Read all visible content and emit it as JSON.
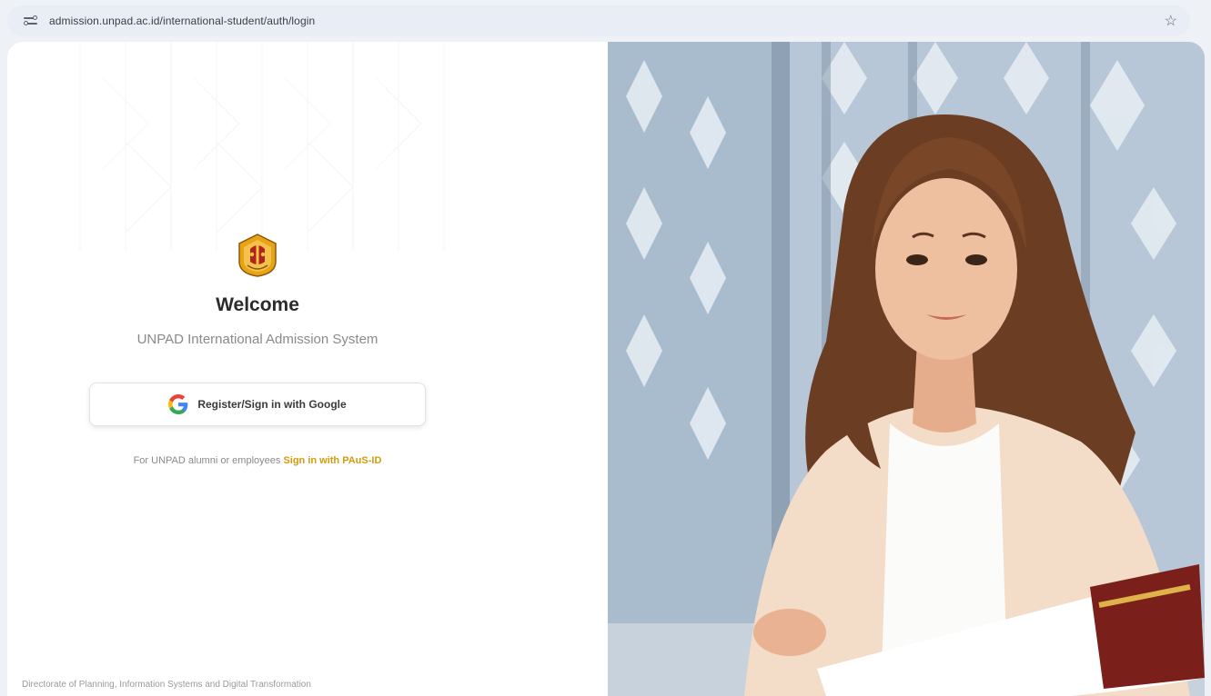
{
  "browser": {
    "url": "admission.unpad.ac.id/international-student/auth/login",
    "bookmark_icon": "star-icon"
  },
  "login": {
    "welcome": "Welcome",
    "subtitle": "UNPAD International Admission System",
    "google_button_label": "Register/Sign in with Google",
    "alt_text": "For UNPAD alumni or employees",
    "alt_link": "Sign in with PAuS-ID"
  },
  "footer": "Directorate of Planning, Information Systems and Digital Transformation",
  "colors": {
    "accent": "#d49a10",
    "logo_gold": "#e8a317",
    "logo_red": "#b0241c"
  }
}
